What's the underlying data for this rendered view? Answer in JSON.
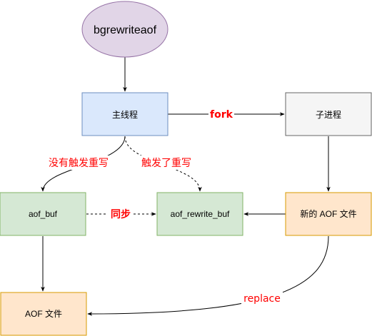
{
  "nodes": {
    "bgrewriteaof": {
      "label": "bgrewriteaof",
      "fill": "#e1d5e7",
      "stroke": "#9673a6"
    },
    "main_process": {
      "label": "主线程",
      "fill": "#dae8fc",
      "stroke": "#6c8ebf"
    },
    "child_process": {
      "label": "子进程",
      "fill": "#f5f5f5",
      "stroke": "#666666"
    },
    "aof_buf": {
      "label": "aof_buf",
      "fill": "#d5e8d4",
      "stroke": "#82b366"
    },
    "aof_rewrite_buf": {
      "label": "aof_rewrite_buf",
      "fill": "#d5e8d4",
      "stroke": "#82b366"
    },
    "new_aof_file": {
      "label": "新的 AOF 文件",
      "fill": "#ffe6cc",
      "stroke": "#d79b00"
    },
    "aof_file": {
      "label": "AOF 文件",
      "fill": "#ffe6cc",
      "stroke": "#d79b00"
    }
  },
  "edges": {
    "fork": {
      "label": "fork"
    },
    "no_rewrite": {
      "label": "没有触发重写"
    },
    "rewrite_triggered": {
      "label": "触发了重写"
    },
    "sync": {
      "label": "同步"
    },
    "replace": {
      "label": "replace"
    }
  },
  "colors": {
    "edge_label": "#ff0000",
    "line": "#000000"
  }
}
